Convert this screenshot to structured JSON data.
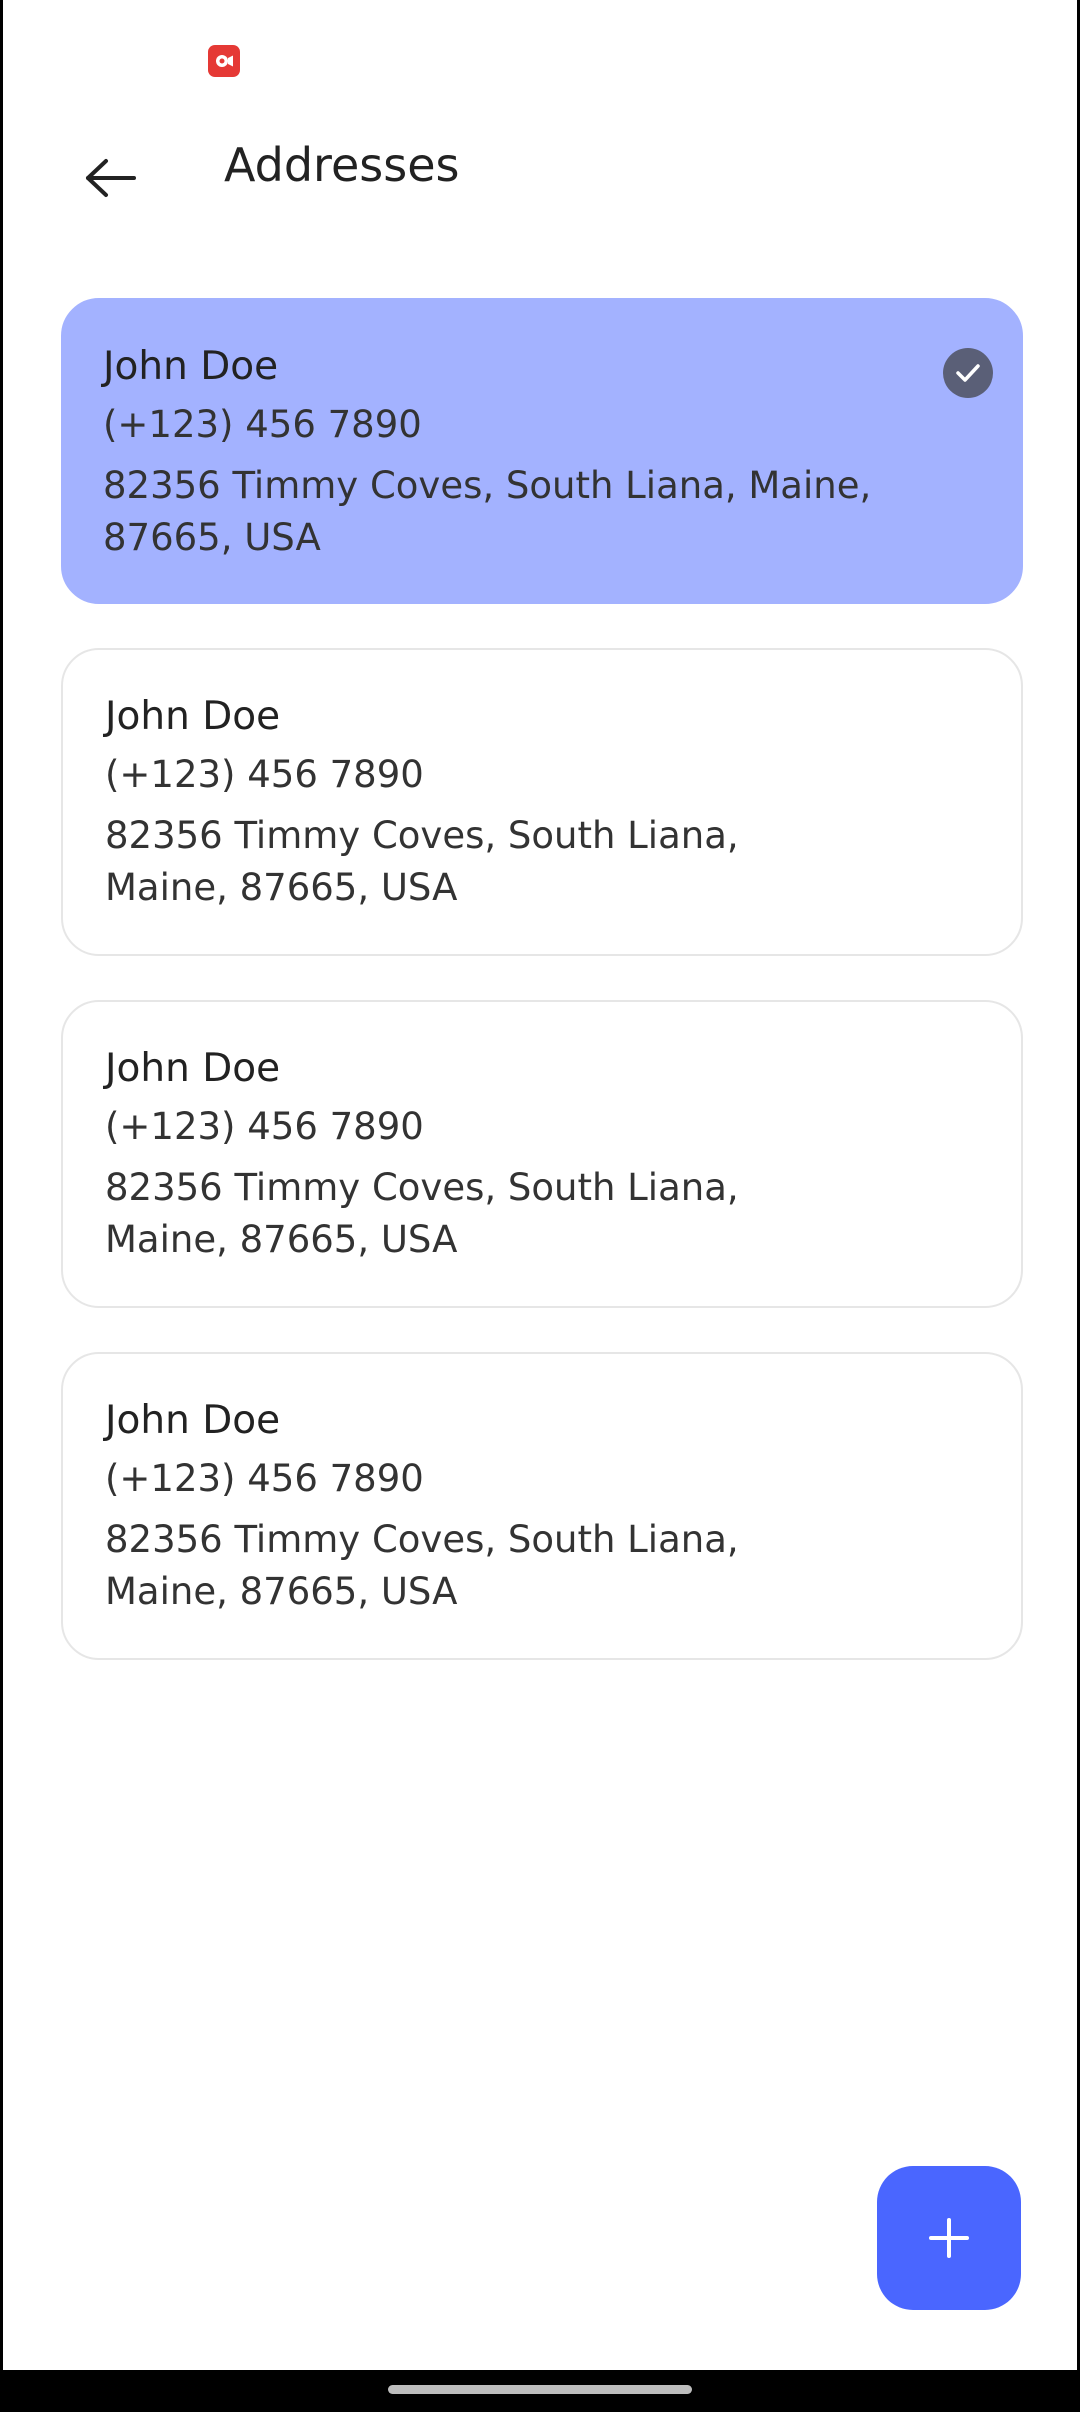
{
  "status_bar": {
    "icons": [
      "screen-record-icon"
    ]
  },
  "app_bar": {
    "back_icon": "arrow-left-icon",
    "title": "Addresses"
  },
  "addresses": [
    {
      "name": "John Doe",
      "phone": "(+123) 456 7890",
      "address": "82356 Timmy Coves, South Liana, Maine, 87665, USA",
      "selected": true
    },
    {
      "name": "John Doe",
      "phone": "(+123) 456 7890",
      "address": "82356 Timmy Coves, South Liana, Maine, 87665, USA",
      "selected": false
    },
    {
      "name": "John Doe",
      "phone": "(+123) 456 7890",
      "address": "82356 Timmy Coves, South Liana, Maine, 87665, USA",
      "selected": false
    },
    {
      "name": "John Doe",
      "phone": "(+123) 456 7890",
      "address": "82356 Timmy Coves, South Liana, Maine, 87665, USA",
      "selected": false
    }
  ],
  "selected_icon": "check-circle-icon",
  "fab": {
    "icon": "plus-icon"
  },
  "colors": {
    "selected_card": "#a3b2ff",
    "check_badge": "#5a5f77",
    "fab": "#4a66ff",
    "record_indicator": "#e53935"
  }
}
